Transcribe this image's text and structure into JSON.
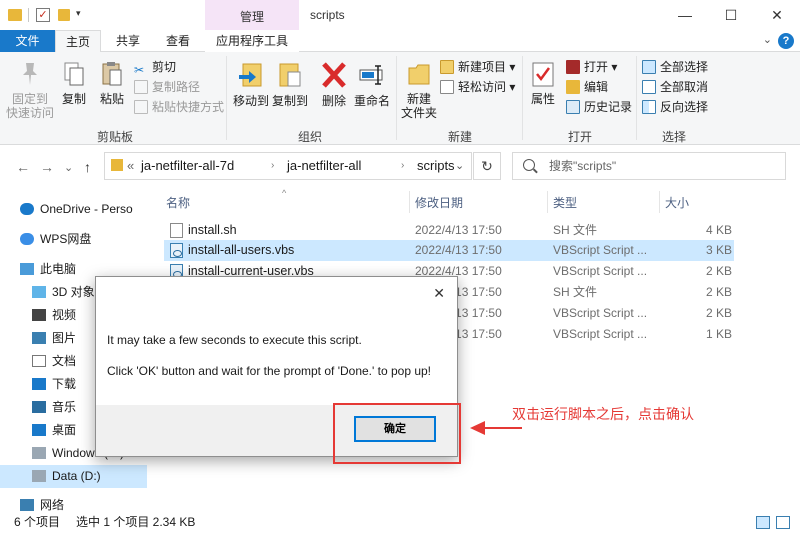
{
  "window": {
    "title": "scripts",
    "context_tab": "管理",
    "minimize": "—",
    "maximize": "☐",
    "close": "✕"
  },
  "tabs": {
    "file": "文件",
    "home": "主页",
    "share": "共享",
    "view": "查看",
    "app_tools": "应用程序工具",
    "collapse": "⌄",
    "help": "?"
  },
  "ribbon": {
    "clipboard": {
      "label": "剪贴板",
      "pin": "固定到\n快速访问",
      "copy": "复制",
      "paste": "粘贴",
      "cut": "剪切",
      "copy_path": "复制路径",
      "paste_shortcut": "粘贴快捷方式"
    },
    "organize": {
      "label": "组织",
      "move_to": "移动到",
      "copy_to": "复制到",
      "delete": "删除",
      "rename": "重命名"
    },
    "new": {
      "label": "新建",
      "new_folder": "新建\n文件夹",
      "new_item": "新建项目 ▾",
      "easy_access": "轻松访问 ▾"
    },
    "open": {
      "label": "打开",
      "properties": "属性",
      "open": "打开 ▾",
      "edit": "编辑",
      "history": "历史记录"
    },
    "select": {
      "label": "选择",
      "select_all": "全部选择",
      "select_none": "全部取消",
      "invert": "反向选择"
    }
  },
  "address": {
    "back": "←",
    "forward": "→",
    "recent": "⌄",
    "up": "↑",
    "overflow": "«",
    "crumbs": [
      "ja-netfilter-all-7d",
      "ja-netfilter-all",
      "scripts"
    ],
    "dropdown": "⌄",
    "refresh": "↻",
    "search_placeholder": "搜索\"scripts\""
  },
  "nav": {
    "items": [
      {
        "label": "OneDrive - Perso"
      },
      {
        "label": "WPS网盘"
      },
      {
        "label": "此电脑"
      },
      {
        "label": "3D 对象"
      },
      {
        "label": "视频"
      },
      {
        "label": "图片"
      },
      {
        "label": "文档"
      },
      {
        "label": "下载"
      },
      {
        "label": "音乐"
      },
      {
        "label": "桌面"
      },
      {
        "label": "Windows (C:)"
      },
      {
        "label": "Data (D:)"
      },
      {
        "label": "网络"
      }
    ]
  },
  "list": {
    "columns": {
      "name": "名称",
      "date": "修改日期",
      "type": "类型",
      "size": "大小"
    },
    "rows": [
      {
        "name": "install.sh",
        "date": "2022/4/13 17:50",
        "type": "SH 文件",
        "size": "4 KB"
      },
      {
        "name": "install-all-users.vbs",
        "date": "2022/4/13 17:50",
        "type": "VBScript Script ...",
        "size": "3 KB"
      },
      {
        "name": "install-current-user.vbs",
        "date": "2022/4/13 17:50",
        "type": "VBScript Script ...",
        "size": "2 KB"
      },
      {
        "name": "",
        "date": "2022/4/13 17:50",
        "type": "SH 文件",
        "size": "2 KB"
      },
      {
        "name": "",
        "date": "2022/4/13 17:50",
        "type": "VBScript Script ...",
        "size": "2 KB"
      },
      {
        "name": "",
        "date": "2022/4/13 17:50",
        "type": "VBScript Script ...",
        "size": "1 KB"
      }
    ]
  },
  "status": {
    "count": "6 个项目",
    "selection": "选中 1 个项目  2.34 KB"
  },
  "dialog": {
    "close": "✕",
    "line1": "It may take a few seconds to execute this script.",
    "line2": "Click 'OK' button and wait for the prompt of 'Done.' to pop up!",
    "ok": "确定"
  },
  "annotation": {
    "text": "双击运行脚本之后，点击确认"
  },
  "colors": {
    "accent": "#1979ca",
    "selection": "#cce8ff",
    "annotation_red": "#e53935"
  }
}
